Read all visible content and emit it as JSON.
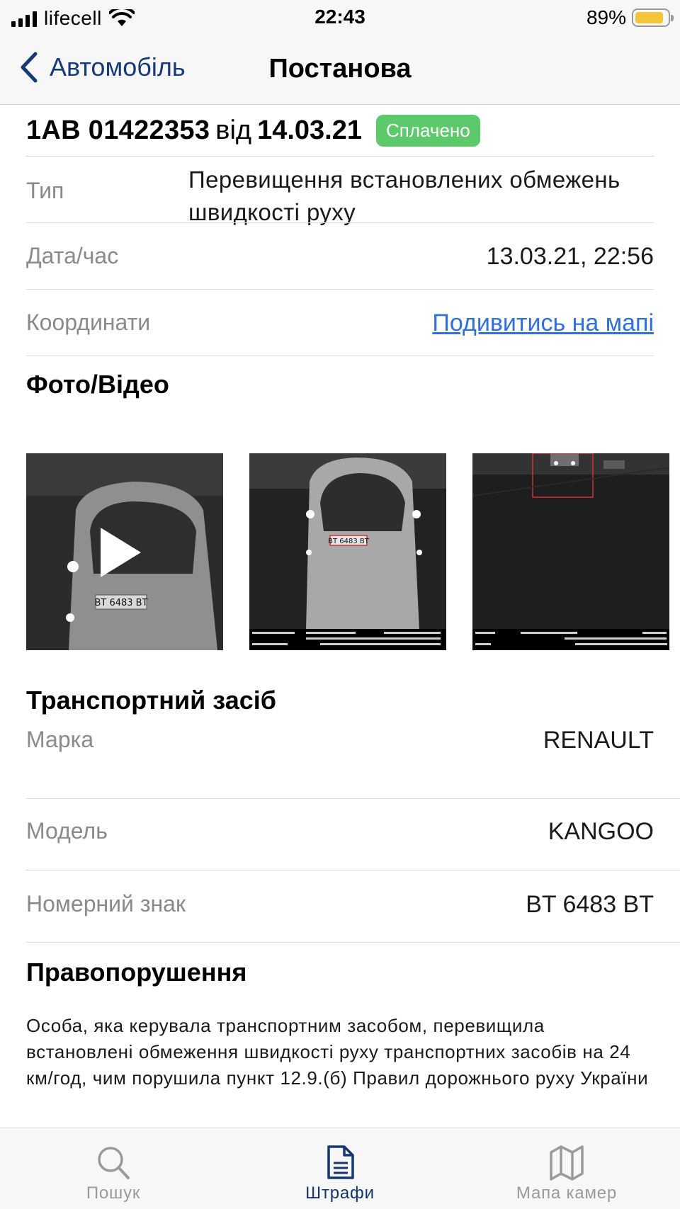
{
  "status_bar": {
    "carrier": "lifecell",
    "time": "22:43",
    "battery_pct": "89%",
    "battery_level": 0.89,
    "battery_color": "#f5c43b"
  },
  "nav": {
    "back_label": "Автомобіль",
    "title": "Постанова"
  },
  "decree": {
    "number": "1AB 01422353",
    "from_word": "від",
    "date": "14.03.21",
    "status": "Сплачено",
    "status_color": "#5cc96a"
  },
  "details": {
    "type_label": "Тип",
    "type_value": "Перевищення встановлених обмежень швидкості руху",
    "datetime_label": "Дата/час",
    "datetime_value": "13.03.21, 22:56",
    "coords_label": "Координати",
    "coords_link": "Подивитись на мапі",
    "link_color": "#2f6fde"
  },
  "media": {
    "title": "Фото/Відео",
    "items": [
      {
        "kind": "video",
        "plate": "BT 6483 BT"
      },
      {
        "kind": "photo",
        "plate": "BT 6483 BT"
      },
      {
        "kind": "photo"
      }
    ]
  },
  "vehicle": {
    "title": "Транспортний засіб",
    "brand_label": "Марка",
    "brand_value": "RENAULT",
    "model_label": "Модель",
    "model_value": "KANGOO",
    "plate_label": "Номерний знак",
    "plate_value": "BT 6483 BT"
  },
  "offense": {
    "title": "Правопорушення",
    "text": "Особа, яка керувала транспортним засобом, перевищила встановлені обмеження швидкості руху транспортних засобів на 24 км/год, чим порушила пункт 12.9.(б) Правил дорожнього руху України"
  },
  "tabbar": {
    "tabs": [
      {
        "label": "Пошук",
        "icon": "search-icon",
        "active": false
      },
      {
        "label": "Штрафи",
        "icon": "document-icon",
        "active": true
      },
      {
        "label": "Мапа камер",
        "icon": "map-icon",
        "active": false
      }
    ],
    "active_color": "#17366f",
    "inactive_color": "#9a9a9a"
  }
}
